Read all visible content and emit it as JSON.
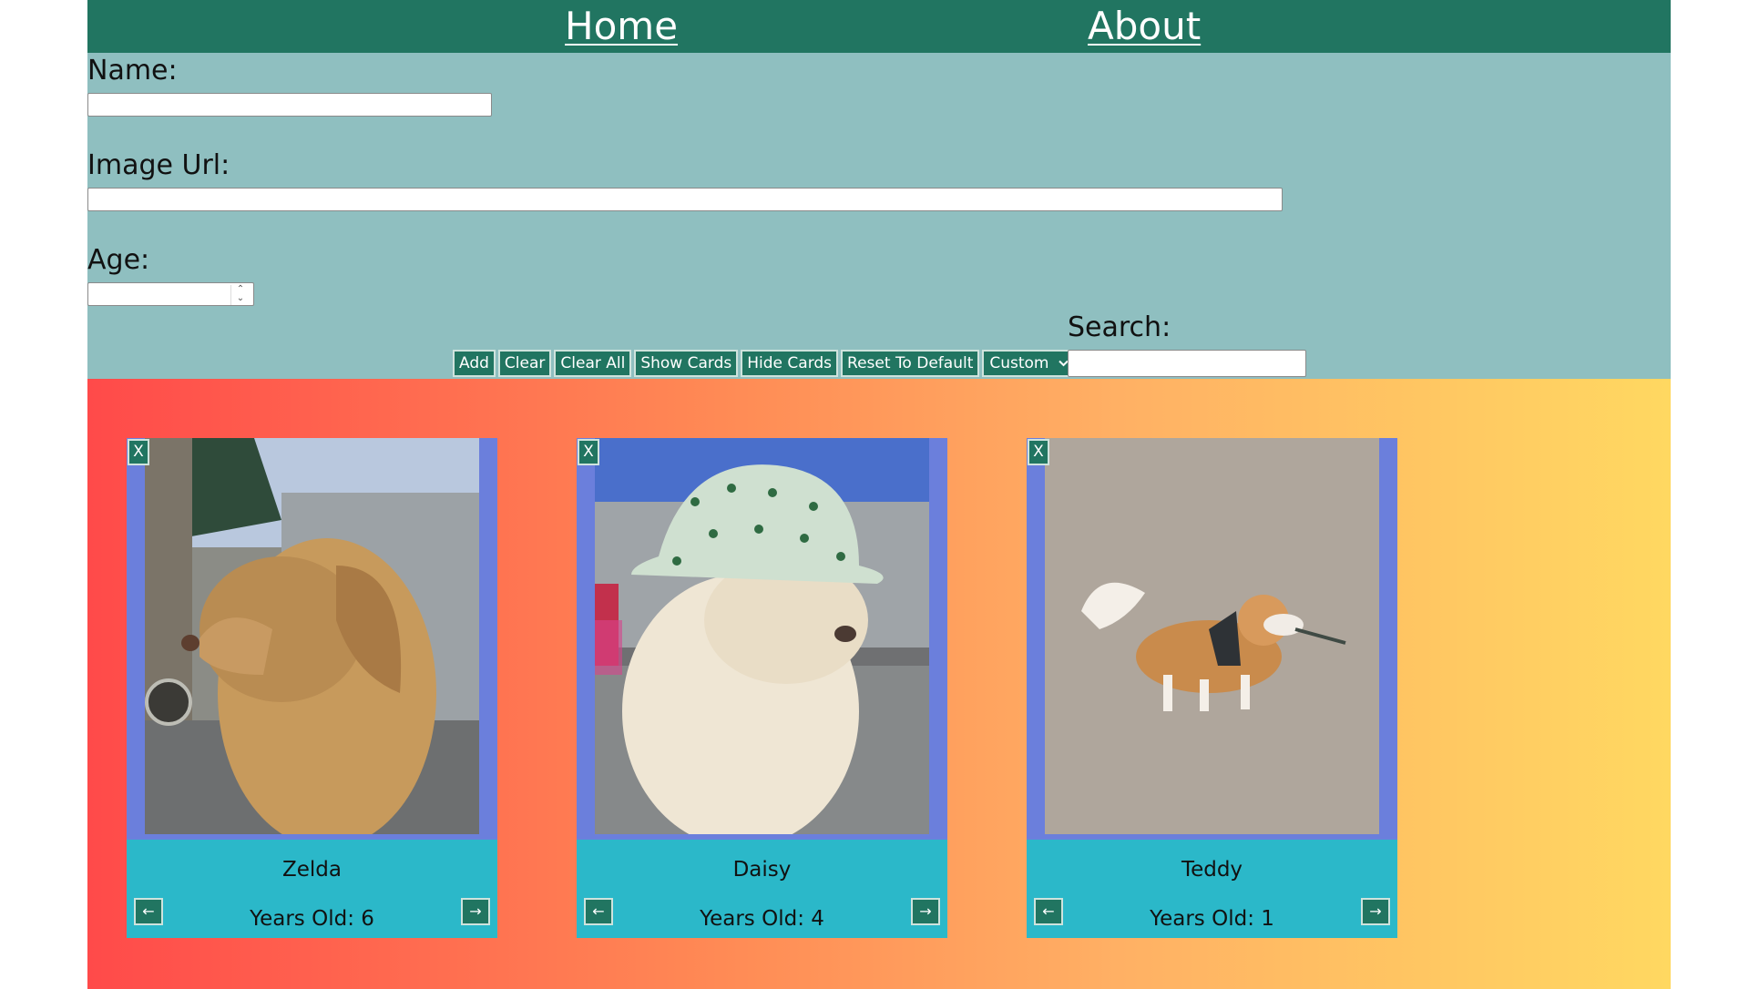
{
  "nav": {
    "home": "Home",
    "about": "About"
  },
  "form": {
    "name_label": "Name:",
    "name_value": "",
    "image_label": "Image Url:",
    "image_value": "",
    "age_label": "Age:",
    "age_value": ""
  },
  "buttons": {
    "add": "Add",
    "clear": "Clear",
    "clear_all": "Clear All",
    "show_cards": "Show Cards",
    "hide_cards": "Hide Cards",
    "reset": "Reset To Default",
    "select_value": "Custom"
  },
  "search": {
    "label": "Search:",
    "value": ""
  },
  "cards": [
    {
      "name": "Zelda",
      "age": "Years Old: 6",
      "remove": "X",
      "prev": "←",
      "next": "→"
    },
    {
      "name": "Daisy",
      "age": "Years Old: 4",
      "remove": "X",
      "prev": "←",
      "next": "→"
    },
    {
      "name": "Teddy",
      "age": "Years Old: 1",
      "remove": "X",
      "prev": "←",
      "next": "→"
    }
  ],
  "colors": {
    "header": "#217561",
    "form_bg": "#8fbfc0",
    "card_frame": "#6b7fdc",
    "card_info": "#2bb8c9",
    "gradient_start": "#ff4a4a",
    "gradient_end": "#ffd861"
  }
}
